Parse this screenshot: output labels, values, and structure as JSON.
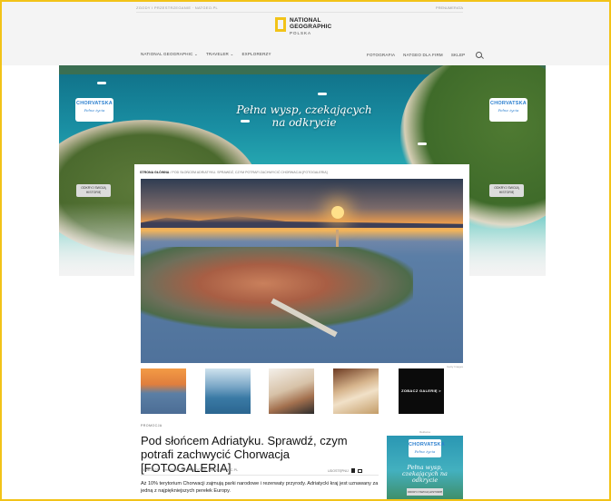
{
  "header": {
    "top_left": "ZGODY I PRZESTRZEGANIE · NATGEO.PL",
    "top_right": "PRENUMERATA",
    "logo_line1": "NATIONAL",
    "logo_line2": "GEOGRAPHIC",
    "logo_line3": "POLSKA",
    "nav_left": [
      "NATIONAL GEOGRAPHIC ⌄",
      "TRAVELER ⌄",
      "EXPLORERZY"
    ],
    "nav_right": [
      "FOTOGRAFIA",
      "NATGEO DLA FIRM",
      "SKLEP"
    ]
  },
  "hero": {
    "title": "Pełna wysp, czekających na odkrycie",
    "badge_main_a": "CHORV",
    "badge_main_b": "A",
    "badge_main_c": "TSKA",
    "badge_sub": "Pełna życia",
    "left_button": "ODKRYJ SWOJĄ HISTORIĘ",
    "right_button": "ODKRYJ SWOJĄ HISTORIĘ"
  },
  "card": {
    "breadcrumb_home": "STRONA GŁÓWNA",
    "breadcrumb_path": "/ POD SŁOŃCEM ADRIATYKU. SPRAWDŹ, CZYM POTRAFI ZACHWYCIĆ CHORWACJA [FOTOGALERIA]",
    "photo_credit": "Getty Images",
    "gallery_button": "ZOBACZ GALERIĘ >"
  },
  "article": {
    "label": "PROMOCJA",
    "title": "Pod słońcem Adriatyku. Sprawdź, czym potrafi zachwycić Chorwacja [FOTOGALERIA]",
    "meta": "15.06.2021 · CHORWACJA W NATIONAL-GEOGRAPHIC.PL",
    "share_label": "UDOSTĘPNIJ",
    "excerpt": "Aż 10% terytorium Chorwacji zajmują parki narodowe i rezerwaty przyrody. Adriatycki kraj jest uznawany za jedną z najpiękniejszych perełek Europy."
  },
  "ad": {
    "label": "Reklama",
    "text": "Pełna wysp, czekających na odkrycie",
    "button": "ODKRYJ SWOJĄ HISTORIĘ"
  },
  "colors": {
    "accent_yellow": "#f2c318",
    "croatia_red": "#e3312b",
    "croatia_blue": "#2b7fcf"
  }
}
